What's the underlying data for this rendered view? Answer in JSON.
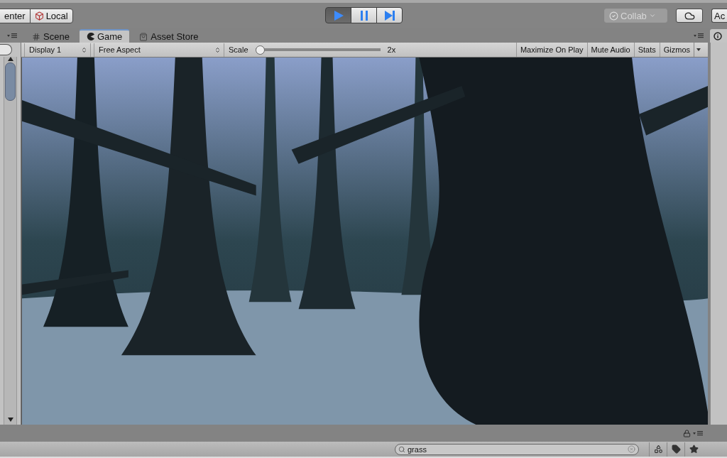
{
  "toolbar": {
    "pivot_buttons": [
      {
        "label": "enter"
      },
      {
        "label": "Local"
      }
    ],
    "playback": [
      {
        "kind": "play",
        "selected": true
      },
      {
        "kind": "pause",
        "selected": false
      },
      {
        "kind": "step",
        "selected": false
      }
    ],
    "collab": {
      "label": "Collab"
    },
    "account_button": {
      "label": "Ac"
    }
  },
  "tabs": [
    {
      "label": "Scene",
      "selected": false
    },
    {
      "label": "Game",
      "selected": true
    },
    {
      "label": "Asset Store",
      "selected": false
    }
  ],
  "game_toolbar": {
    "display": "Display 1",
    "aspect": "Free Aspect",
    "scale_label": "Scale",
    "scale": {
      "level": 0.0
    },
    "scale_reading": "2x",
    "toggles": [
      {
        "label": "Maximize On Play",
        "on": false
      },
      {
        "label": "Mute Audio",
        "on": false
      },
      {
        "label": "Stats",
        "on": false
      },
      {
        "label": "Gizmos",
        "on": false
      }
    ]
  },
  "project_bar": {
    "search": {
      "value": "grass"
    }
  }
}
